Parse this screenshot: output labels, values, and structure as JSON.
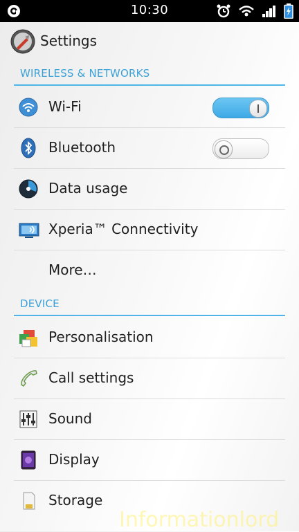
{
  "status_bar": {
    "time": "10:30",
    "icons": [
      "app-notification-icon",
      "alarm-clock-icon",
      "wifi-signal-icon",
      "cell-signal-icon",
      "battery-charging-icon"
    ]
  },
  "action_bar": {
    "title": "Settings",
    "icon": "settings-app-icon"
  },
  "sections": [
    {
      "header": "WIRELESS & NETWORKS",
      "items": [
        {
          "label": "Wi-Fi",
          "icon": "wifi-icon",
          "toggle": "on"
        },
        {
          "label": "Bluetooth",
          "icon": "bluetooth-icon",
          "toggle": "off"
        },
        {
          "label": "Data usage",
          "icon": "data-usage-icon"
        },
        {
          "label": "Xperia™ Connectivity",
          "icon": "xperia-connectivity-icon"
        },
        {
          "label": "More…"
        }
      ]
    },
    {
      "header": "DEVICE",
      "items": [
        {
          "label": "Personalisation",
          "icon": "personalisation-icon"
        },
        {
          "label": "Call settings",
          "icon": "phone-handset-icon"
        },
        {
          "label": "Sound",
          "icon": "equalizer-icon"
        },
        {
          "label": "Display",
          "icon": "display-icon"
        },
        {
          "label": "Storage",
          "icon": "sd-card-icon"
        }
      ]
    }
  ],
  "watermark": "Informationlord",
  "colors": {
    "accent": "#3aa1d8",
    "statusbar": "#000000"
  }
}
